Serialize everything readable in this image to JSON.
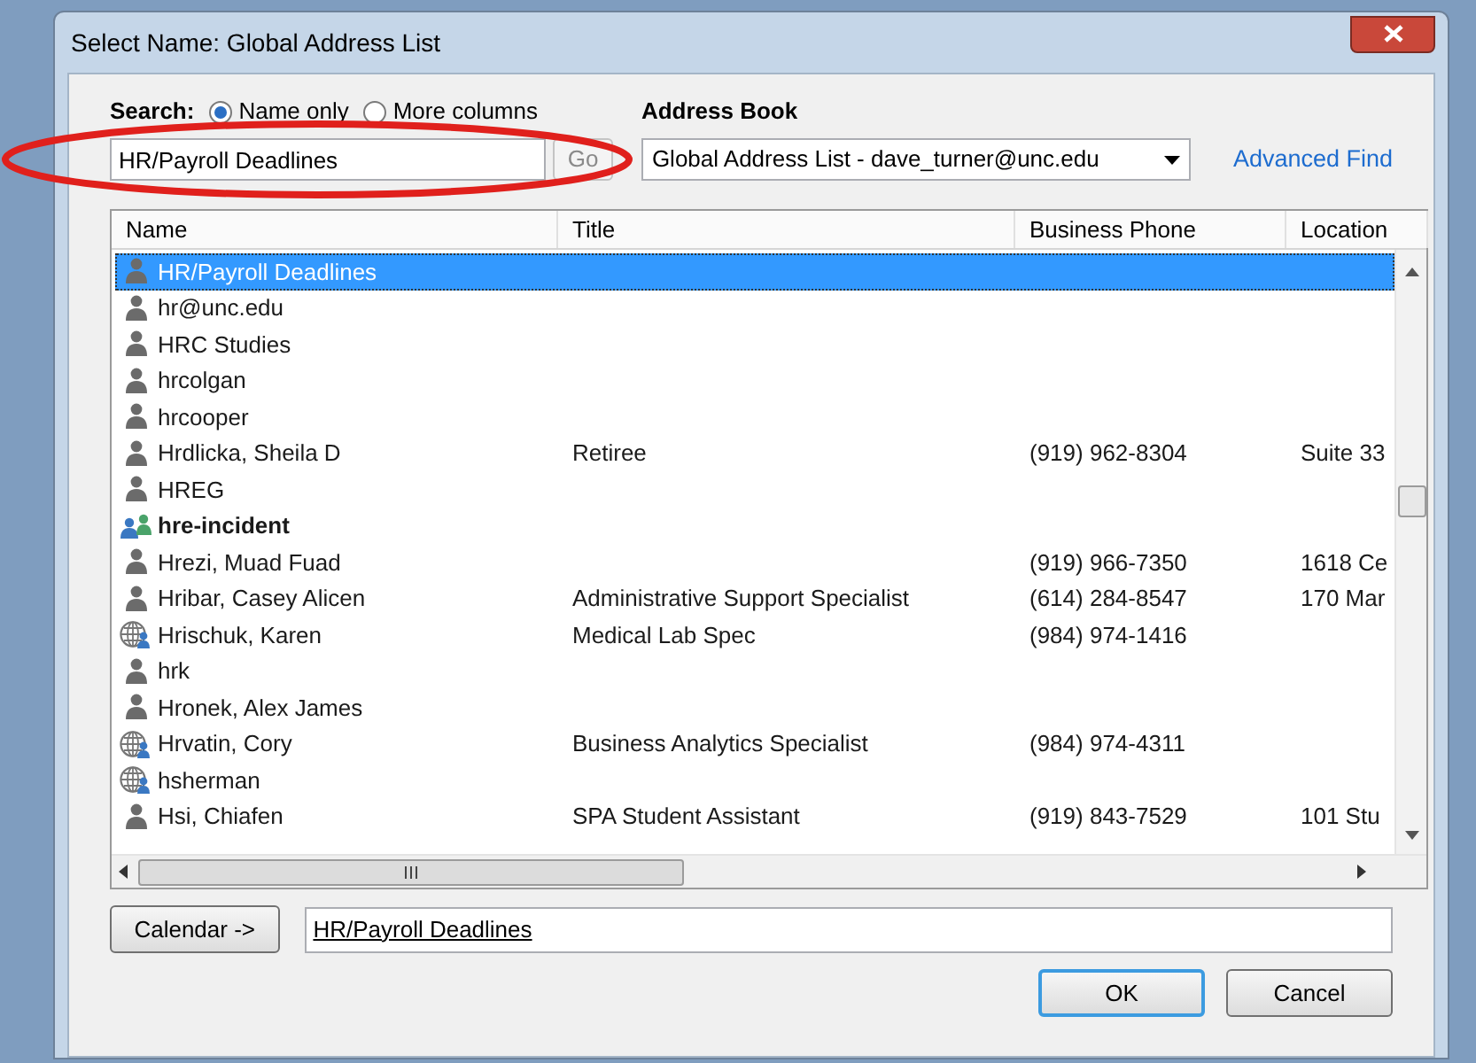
{
  "window": {
    "title": "Select Name: Global Address List"
  },
  "search": {
    "label": "Search:",
    "options": [
      {
        "label": "Name only",
        "selected": true
      },
      {
        "label": "More columns",
        "selected": false
      }
    ],
    "value": "HR/Payroll Deadlines",
    "go_button": "Go",
    "go_disabled": true
  },
  "address_book": {
    "label": "Address Book",
    "value": "Global Address List - dave_turner@unc.edu",
    "advanced_find": "Advanced Find"
  },
  "table": {
    "columns": [
      "Name",
      "Title",
      "Business Phone",
      "Location"
    ],
    "rows": [
      {
        "kind": "user",
        "name": "HR/Payroll Deadlines",
        "selected": true
      },
      {
        "kind": "user",
        "name": "hr@unc.edu",
        "selected": false
      },
      {
        "kind": "user",
        "name": "HRC Studies",
        "selected": false
      },
      {
        "kind": "user",
        "name": "hrcolgan",
        "selected": false
      },
      {
        "kind": "user",
        "name": "hrcooper",
        "selected": false
      },
      {
        "kind": "user",
        "name": "Hrdlicka, Sheila D",
        "title": "Retiree",
        "phone": "(919) 962-8304",
        "location": "Suite 33",
        "selected": false
      },
      {
        "kind": "user",
        "name": "HREG",
        "selected": false
      },
      {
        "kind": "group",
        "name": "hre-incident",
        "selected": false
      },
      {
        "kind": "user",
        "name": "Hrezi, Muad Fuad",
        "phone": "(919) 966-7350",
        "location": "1618 Ce",
        "selected": false
      },
      {
        "kind": "user",
        "name": "Hribar, Casey Alicen",
        "title": "Administrative Support Specialist",
        "phone": "(614) 284-8547",
        "location": "170 Mar",
        "selected": false
      },
      {
        "kind": "external",
        "name": "Hrischuk, Karen",
        "title": "Medical Lab Spec",
        "phone": "(984) 974-1416",
        "selected": false
      },
      {
        "kind": "user",
        "name": "hrk",
        "selected": false
      },
      {
        "kind": "user",
        "name": "Hronek, Alex James",
        "selected": false
      },
      {
        "kind": "external",
        "name": "Hrvatin, Cory",
        "title": "Business Analytics Specialist",
        "phone": "(984) 974-4311",
        "selected": false
      },
      {
        "kind": "external",
        "name": "hsherman",
        "selected": false
      },
      {
        "kind": "user",
        "name": "Hsi, Chiafen",
        "title": "SPA Student Assistant",
        "phone": "(919) 843-7529",
        "location": "101 Stu",
        "selected": false
      }
    ]
  },
  "recipient": {
    "button": "Calendar ->",
    "value": "HR/Payroll Deadlines"
  },
  "buttons": [
    {
      "label": "OK",
      "default": true
    },
    {
      "label": "Cancel",
      "default": false
    }
  ]
}
